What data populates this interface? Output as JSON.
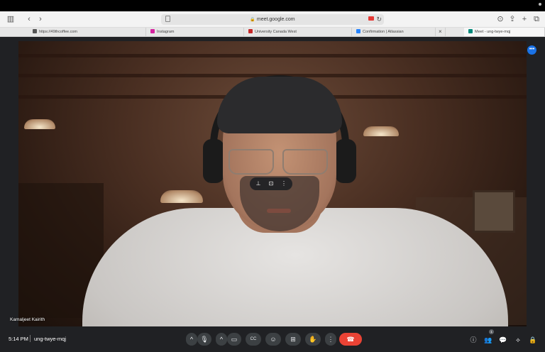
{
  "browser": {
    "address": "meet.google.com",
    "tabs": [
      {
        "label": "https://49thcoffee.com",
        "favicon_color": "#555555"
      },
      {
        "label": "Instagram",
        "favicon_color": "#d6249f"
      },
      {
        "label": "University Canada West",
        "favicon_color": "#c62828"
      },
      {
        "label": "Confirmation | Atlassian",
        "favicon_color": "#2684ff"
      },
      {
        "label": "Meet - ung-twye-mqj",
        "favicon_color": "#00897b"
      }
    ],
    "close_tab_glyph": "×"
  },
  "meet": {
    "participant_name": "Kamaljeet Kairith",
    "time": "5:14 PM",
    "meeting_code": "ung-twye-mqj",
    "people_count": "1",
    "tile_menu": {
      "pin": "pin-icon",
      "frame": "frame-icon",
      "more": "more-vert-icon"
    },
    "more_button_glyph": "•••",
    "controls": [
      {
        "name": "mic-options-button",
        "glyph": "^"
      },
      {
        "name": "mic-button",
        "glyph": "🎙"
      },
      {
        "name": "camera-options-button",
        "glyph": "^"
      },
      {
        "name": "camera-button",
        "glyph": "▭"
      },
      {
        "name": "captions-button",
        "glyph": "CC"
      },
      {
        "name": "emoji-button",
        "glyph": "☺"
      },
      {
        "name": "present-button",
        "glyph": "⊞"
      },
      {
        "name": "raise-hand-button",
        "glyph": "✋"
      },
      {
        "name": "more-options-button",
        "glyph": "⋮"
      },
      {
        "name": "leave-call-button",
        "glyph": "☎"
      }
    ],
    "right_controls": [
      {
        "name": "info-button",
        "glyph": "ⓘ"
      },
      {
        "name": "people-button",
        "glyph": "👥"
      },
      {
        "name": "chat-button",
        "glyph": "💬"
      },
      {
        "name": "activities-button",
        "glyph": "⟡"
      },
      {
        "name": "host-controls-button",
        "glyph": "🔒"
      }
    ],
    "colors": {
      "accent": "#1a73e8",
      "end_call": "#ea4335",
      "background": "#202124"
    }
  }
}
